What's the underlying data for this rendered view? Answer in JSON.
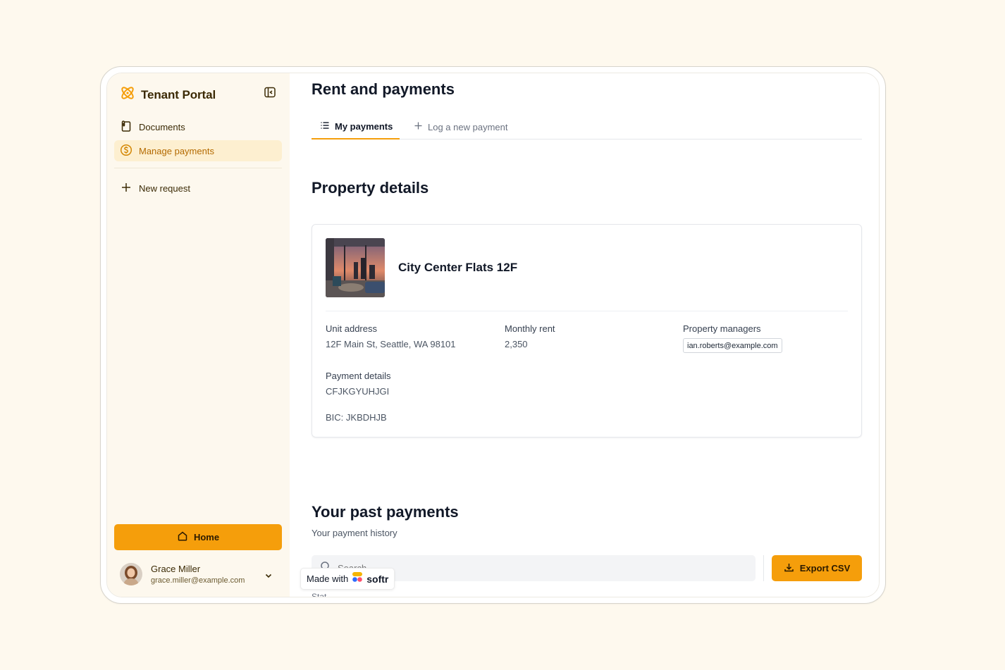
{
  "app": {
    "name": "Tenant Portal"
  },
  "sidebar": {
    "items": [
      {
        "label": "Documents",
        "icon": "paper-clip-icon"
      },
      {
        "label": "Manage payments",
        "icon": "dollar-circle-icon",
        "active": true
      }
    ],
    "new_request_label": "New request",
    "home_label": "Home",
    "user": {
      "name": "Grace Miller",
      "email": "grace.miller@example.com"
    }
  },
  "main": {
    "title": "Rent and payments",
    "tabs": [
      {
        "label": "My payments",
        "active": true
      },
      {
        "label": "Log a new payment"
      }
    ],
    "property_section": {
      "title": "Property details",
      "name": "City Center Flats 12F",
      "fields": {
        "unit_address": {
          "label": "Unit address",
          "value": "12F Main St, Seattle, WA 98101"
        },
        "monthly_rent": {
          "label": "Monthly rent",
          "value": "2,350"
        },
        "property_managers": {
          "label": "Property managers",
          "value": "ian.roberts@example.com"
        },
        "payment_details": {
          "label": "Payment details",
          "value": "CFJKGYUHJGI",
          "bic": "BIC: JKBDHJB"
        }
      }
    },
    "payments_section": {
      "title": "Your past payments",
      "subtitle": "Your payment history",
      "search_placeholder": "Search",
      "export_label": "Export CSV",
      "cut_label": "Stat"
    }
  },
  "badge": {
    "made_with": "Made with",
    "brand": "softr"
  },
  "colors": {
    "accent": "#f59e0b",
    "sidebar_bg": "#fdf8ee",
    "active_item_bg": "#fdefd0",
    "page_bg": "#fef9ee"
  }
}
